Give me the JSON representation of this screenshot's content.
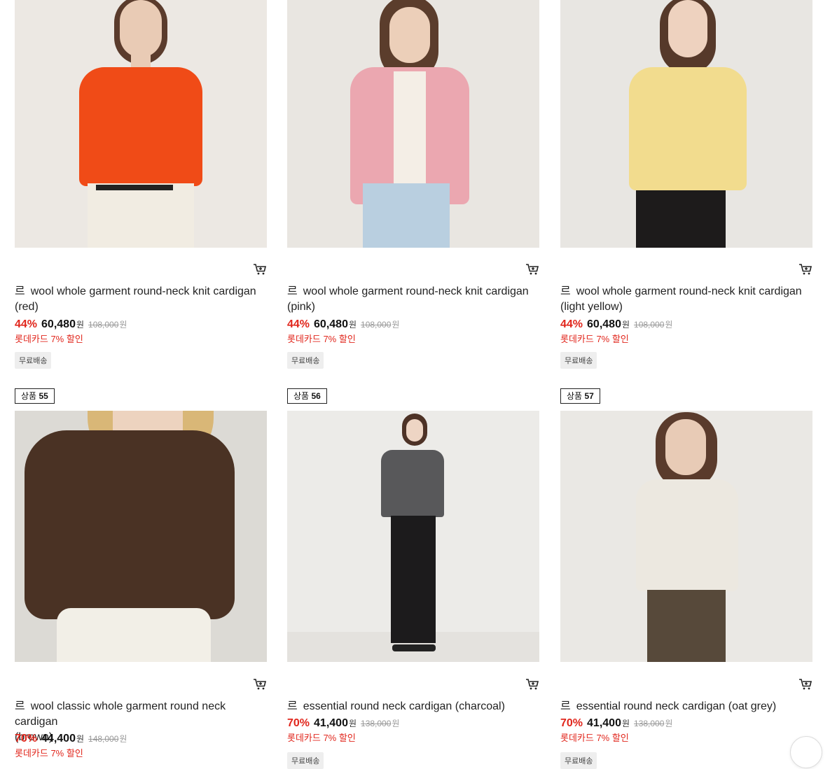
{
  "products": [
    {
      "brand": "르",
      "name": "wool whole garment round-neck knit cardigan",
      "variant": "(red)",
      "discount": "44%",
      "price": "60,480",
      "currency": "원",
      "original_price": "108,000",
      "card_discount": "롯데카드 7% 할인",
      "badge": "무료배송",
      "colors": {
        "wall": "#ece8e3",
        "garment": "#f04b17",
        "bottom": "#f1ece2",
        "skin": "#e9cbb5",
        "hair": "#5a3b2c"
      }
    },
    {
      "brand": "르",
      "name": "wool whole garment round-neck knit cardigan",
      "variant": "(pink)",
      "discount": "44%",
      "price": "60,480",
      "currency": "원",
      "original_price": "108,000",
      "card_discount": "롯데카드 7% 할인",
      "badge": "무료배송",
      "colors": {
        "wall": "#e9e6e1",
        "garment": "#eba7b0",
        "bottom": "#b9cfe0",
        "skin": "#eccfb9",
        "hair": "#5b3d2c"
      }
    },
    {
      "brand": "르",
      "name": "wool whole garment round-neck knit cardigan",
      "variant": "(light yellow)",
      "discount": "44%",
      "price": "60,480",
      "currency": "원",
      "original_price": "108,000",
      "card_discount": "롯데카드 7% 할인",
      "badge": "무료배송",
      "colors": {
        "wall": "#e8e6e2",
        "garment": "#f2dc8e",
        "bottom": "#1d1b1b",
        "skin": "#eed2bf",
        "hair": "#56392a"
      }
    },
    {
      "rank_label": "상품",
      "rank_number": "55",
      "brand": "르",
      "name": "wool classic whole garment round neck cardigan",
      "variant": "(brown)",
      "discount": "70%",
      "price": "44,400",
      "currency": "원",
      "original_price": "148,000",
      "card_discount": "롯데카드 7% 할인",
      "colors": {
        "wall": "#dcdad5",
        "garment": "#4a3224",
        "bottom": "#f2efe7",
        "skin": "#edd3bf",
        "hair": "#d9b777"
      }
    },
    {
      "rank_label": "상품",
      "rank_number": "56",
      "brand": "르",
      "name": "essential round neck cardigan (charcoal)",
      "variant": "",
      "discount": "70%",
      "price": "41,400",
      "currency": "원",
      "original_price": "138,000",
      "card_discount": "롯데카드 7% 할인",
      "badge": "무료배송",
      "colors": {
        "wall": "#ecebe8",
        "garment": "#58585a",
        "bottom": "#1c1b1c",
        "skin": "#eed5c4",
        "hair": "#4d3226"
      }
    },
    {
      "rank_label": "상품",
      "rank_number": "57",
      "brand": "르",
      "name": "essential round neck cardigan (oat grey)",
      "variant": "",
      "discount": "70%",
      "price": "41,400",
      "currency": "원",
      "original_price": "138,000",
      "card_discount": "롯데카드 7% 할인",
      "badge": "무료배송",
      "colors": {
        "wall": "#eae8e4",
        "garment": "#ece8e0",
        "bottom": "#57493a",
        "skin": "#e8cbb6",
        "hair": "#5a3b2c"
      }
    }
  ]
}
